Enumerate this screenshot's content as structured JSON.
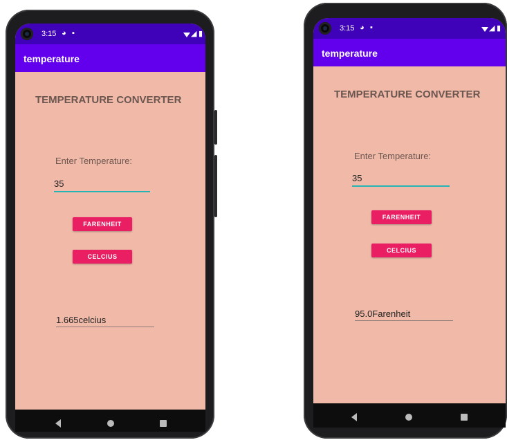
{
  "phones": [
    {
      "status": {
        "time": "3:15"
      },
      "app_title": "temperature",
      "heading": "TEMPERATURE CONVERTER",
      "input_label": "Enter Temperature:",
      "input_value": "35",
      "farenheit_label": "FARENHEIT",
      "celcius_label": "CELCIUS",
      "result": "1.665celcius"
    },
    {
      "status": {
        "time": "3:15"
      },
      "app_title": "temperature",
      "heading": "TEMPERATURE CONVERTER",
      "input_label": "Enter Temperature:",
      "input_value": "35",
      "farenheit_label": "FARENHEIT",
      "celcius_label": "CELCIUS",
      "result": "95.0Farenheit"
    }
  ],
  "colors": {
    "status_bar": "#3f02b8",
    "app_bar": "#6200ee",
    "background": "#f0b9a8",
    "button": "#e91e63",
    "input_underline": "#26b3b3"
  },
  "icons": [
    "camera-icon",
    "settings-status-icon",
    "sd-card-icon",
    "wifi-icon",
    "signal-icon",
    "battery-icon",
    "back-icon",
    "home-icon",
    "recents-icon"
  ]
}
